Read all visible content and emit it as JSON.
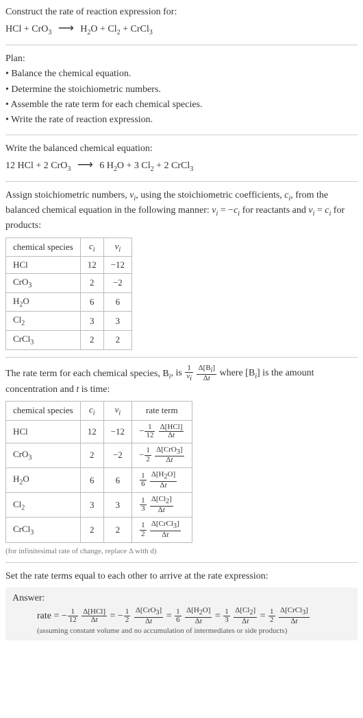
{
  "intro": {
    "construct_line": "Construct the rate of reaction expression for:",
    "equation_html": "HCl + CrO<sub>3</sub> <span class=\"arrow\">⟶</span> H<sub>2</sub>O + Cl<sub>2</sub> + CrCl<sub>3</sub>"
  },
  "plan": {
    "title": "Plan:",
    "bullets": [
      "• Balance the chemical equation.",
      "• Determine the stoichiometric numbers.",
      "• Assemble the rate term for each chemical species.",
      "• Write the rate of reaction expression."
    ]
  },
  "balance": {
    "title": "Write the balanced chemical equation:",
    "equation_html": "12 HCl + 2 CrO<sub>3</sub> <span class=\"arrow\">⟶</span> 6 H<sub>2</sub>O + 3 Cl<sub>2</sub> + 2 CrCl<sub>3</sub>"
  },
  "assign": {
    "text_html": "Assign stoichiometric numbers, <span class=\"italic\">ν<sub>i</sub></span>, using the stoichiometric coefficients, <span class=\"italic\">c<sub>i</sub></span>, from the balanced chemical equation in the following manner: <span class=\"italic\">ν<sub>i</sub></span> = −<span class=\"italic\">c<sub>i</sub></span> for reactants and <span class=\"italic\">ν<sub>i</sub></span> = <span class=\"italic\">c<sub>i</sub></span> for products:"
  },
  "table1": {
    "headers": {
      "species": "chemical species",
      "ci_html": "<span class=\"italic\">c<sub>i</sub></span>",
      "vi_html": "<span class=\"italic\">ν<sub>i</sub></span>"
    },
    "rows": [
      {
        "species_html": "HCl",
        "ci": "12",
        "vi": "−12"
      },
      {
        "species_html": "CrO<sub>3</sub>",
        "ci": "2",
        "vi": "−2"
      },
      {
        "species_html": "H<sub>2</sub>O",
        "ci": "6",
        "vi": "6"
      },
      {
        "species_html": "Cl<sub>2</sub>",
        "ci": "3",
        "vi": "3"
      },
      {
        "species_html": "CrCl<sub>3</sub>",
        "ci": "2",
        "vi": "2"
      }
    ]
  },
  "rate_term_intro": {
    "before": "The rate term for each chemical species, B",
    "after_html": ", is <span class=\"frac\"><span class=\"num\">1</span><span class=\"den\"><span class=\"italic\">ν<sub>i</sub></span></span></span> <span class=\"frac\"><span class=\"num\">Δ[B<sub><i>i</i></sub>]</span><span class=\"den\">Δ<i>t</i></span></span> where [B<sub><i>i</i></sub>] is the amount concentration and <i>t</i> is time:"
  },
  "table2": {
    "headers": {
      "species": "chemical species",
      "ci_html": "<span class=\"italic\">c<sub>i</sub></span>",
      "vi_html": "<span class=\"italic\">ν<sub>i</sub></span>",
      "rate": "rate term"
    },
    "rows": [
      {
        "species_html": "HCl",
        "ci": "12",
        "vi": "−12",
        "rate_html": "−<span class=\"frac\"><span class=\"num\">1</span><span class=\"den\">12</span></span> <span class=\"frac\"><span class=\"num\">Δ[HCl]</span><span class=\"den\">Δ<i>t</i></span></span>"
      },
      {
        "species_html": "CrO<sub>3</sub>",
        "ci": "2",
        "vi": "−2",
        "rate_html": "−<span class=\"frac\"><span class=\"num\">1</span><span class=\"den\">2</span></span> <span class=\"frac\"><span class=\"num\">Δ[CrO<sub>3</sub>]</span><span class=\"den\">Δ<i>t</i></span></span>"
      },
      {
        "species_html": "H<sub>2</sub>O",
        "ci": "6",
        "vi": "6",
        "rate_html": "<span class=\"frac\"><span class=\"num\">1</span><span class=\"den\">6</span></span> <span class=\"frac\"><span class=\"num\">Δ[H<sub>2</sub>O]</span><span class=\"den\">Δ<i>t</i></span></span>"
      },
      {
        "species_html": "Cl<sub>2</sub>",
        "ci": "3",
        "vi": "3",
        "rate_html": "<span class=\"frac\"><span class=\"num\">1</span><span class=\"den\">3</span></span> <span class=\"frac\"><span class=\"num\">Δ[Cl<sub>2</sub>]</span><span class=\"den\">Δ<i>t</i></span></span>"
      },
      {
        "species_html": "CrCl<sub>3</sub>",
        "ci": "2",
        "vi": "2",
        "rate_html": "<span class=\"frac\"><span class=\"num\">1</span><span class=\"den\">2</span></span> <span class=\"frac\"><span class=\"num\">Δ[CrCl<sub>3</sub>]</span><span class=\"den\">Δ<i>t</i></span></span>"
      }
    ]
  },
  "infinitesimal_note": "(for infinitesimal rate of change, replace Δ with d)",
  "set_equal": "Set the rate terms equal to each other to arrive at the rate expression:",
  "answer": {
    "label": "Answer:",
    "rate_html": "rate = −<span class=\"frac\"><span class=\"num\">1</span><span class=\"den\">12</span></span> <span class=\"frac\"><span class=\"num\">Δ[HCl]</span><span class=\"den\">Δ<i>t</i></span></span> = −<span class=\"frac\"><span class=\"num\">1</span><span class=\"den\">2</span></span> <span class=\"frac\"><span class=\"num\">Δ[CrO<sub>3</sub>]</span><span class=\"den\">Δ<i>t</i></span></span> = <span class=\"frac\"><span class=\"num\">1</span><span class=\"den\">6</span></span> <span class=\"frac\"><span class=\"num\">Δ[H<sub>2</sub>O]</span><span class=\"den\">Δ<i>t</i></span></span> = <span class=\"frac\"><span class=\"num\">1</span><span class=\"den\">3</span></span> <span class=\"frac\"><span class=\"num\">Δ[Cl<sub>2</sub>]</span><span class=\"den\">Δ<i>t</i></span></span> = <span class=\"frac\"><span class=\"num\">1</span><span class=\"den\">2</span></span> <span class=\"frac\"><span class=\"num\">Δ[CrCl<sub>3</sub>]</span><span class=\"den\">Δ<i>t</i></span></span>",
    "assumption": "(assuming constant volume and no accumulation of intermediates or side products)"
  },
  "chart_data": {
    "type": "table",
    "title": "Stoichiometric numbers and rate terms for 12 HCl + 2 CrO3 → 6 H2O + 3 Cl2 + 2 CrCl3",
    "columns": [
      "chemical species",
      "c_i",
      "ν_i",
      "rate term"
    ],
    "rows": [
      [
        "HCl",
        12,
        -12,
        "-(1/12) d[HCl]/dt"
      ],
      [
        "CrO3",
        2,
        -2,
        "-(1/2) d[CrO3]/dt"
      ],
      [
        "H2O",
        6,
        6,
        "(1/6) d[H2O]/dt"
      ],
      [
        "Cl2",
        3,
        3,
        "(1/3) d[Cl2]/dt"
      ],
      [
        "CrCl3",
        2,
        2,
        "(1/2) d[CrCl3]/dt"
      ]
    ]
  }
}
